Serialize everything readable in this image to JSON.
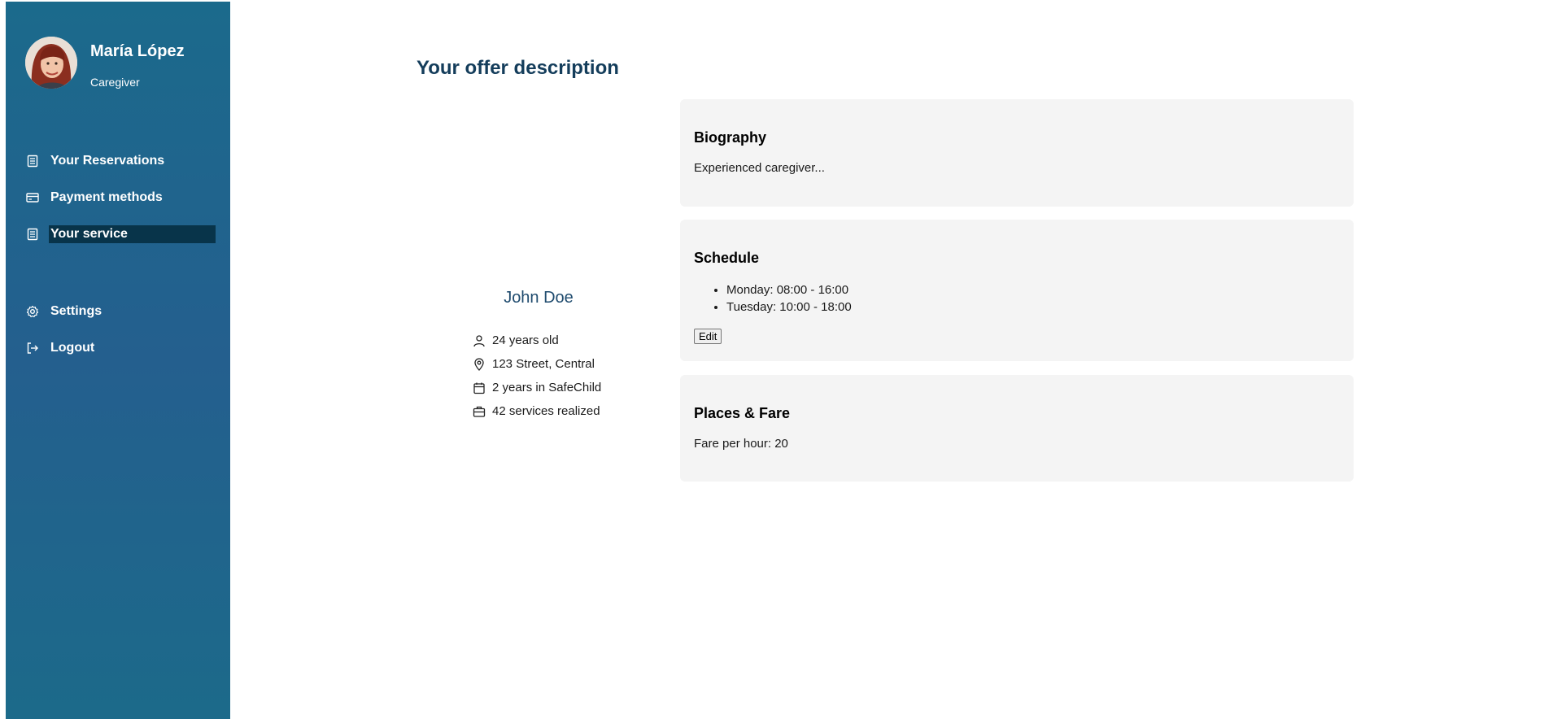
{
  "sidebar": {
    "user_name": "María López",
    "user_role": "Caregiver",
    "avatar_icon": "user-avatar-photo",
    "nav_top": [
      {
        "label": "Your Reservations",
        "icon": "document-icon"
      },
      {
        "label": "Payment methods",
        "icon": "credit-card-icon"
      },
      {
        "label": "Your service",
        "icon": "document-icon",
        "active": true
      }
    ],
    "nav_bottom": [
      {
        "label": "Settings",
        "icon": "gear-icon"
      },
      {
        "label": "Logout",
        "icon": "logout-icon"
      }
    ],
    "colors": {
      "bg_top": "#1b6a8c",
      "bg_mid": "#245f8e",
      "active_bg": "#08344a"
    }
  },
  "main": {
    "title": "Your offer description",
    "person": {
      "name": "John Doe",
      "facts": [
        {
          "text": "24 years old",
          "icon": "person-icon"
        },
        {
          "text": "123 Street, Central",
          "icon": "location-pin-icon"
        },
        {
          "text": "2 years in SafeChild",
          "icon": "calendar-icon"
        },
        {
          "text": "42 services realized",
          "icon": "briefcase-icon"
        }
      ]
    },
    "biography": {
      "heading": "Biography",
      "text": "Experienced caregiver..."
    },
    "schedule": {
      "heading": "Schedule",
      "items": [
        "Monday: 08:00 - 16:00",
        "Tuesday: 10:00 - 18:00"
      ],
      "edit_label": "Edit"
    },
    "places": {
      "heading": "Places & Fare",
      "text": "Fare per hour: 20"
    }
  }
}
